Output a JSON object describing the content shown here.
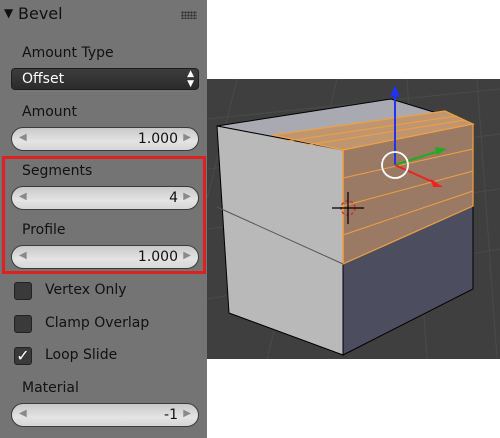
{
  "panel": {
    "title": "Bevel",
    "amount_type": {
      "label": "Amount Type",
      "value": "Offset"
    },
    "amount": {
      "label": "Amount",
      "value": "1.000"
    },
    "segments": {
      "label": "Segments",
      "value": "4"
    },
    "profile": {
      "label": "Profile",
      "value": "1.000"
    },
    "vertex_only": {
      "label": "Vertex Only",
      "checked": false
    },
    "clamp_overlap": {
      "label": "Clamp Overlap",
      "checked": false
    },
    "loop_slide": {
      "label": "Loop Slide",
      "checked": true,
      "mark": "✓"
    },
    "material": {
      "label": "Material",
      "value": "-1"
    }
  },
  "colors": {
    "panel_bg": "#747474",
    "highlight_border": "#e02020",
    "selection_orange": "#f0a040",
    "viewport_bg": "#3f3f3f"
  },
  "icons": {
    "collapse": "triangle-down-icon",
    "grip": "grip-dots-icon",
    "arrow_left": "arrow-left-icon",
    "arrow_right": "arrow-right-icon"
  }
}
